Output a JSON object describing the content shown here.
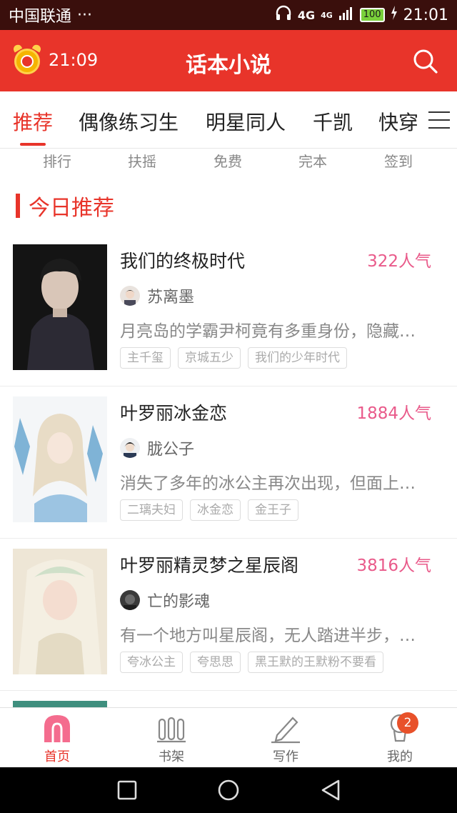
{
  "statusbar": {
    "carrier": "中国联通",
    "dots": "···",
    "network": "4G",
    "network2": "4G",
    "battery": "100",
    "time": "21:01"
  },
  "appbar": {
    "timer": "21:09",
    "title": "话本小说"
  },
  "tabs": [
    "推荐",
    "偶像练习生",
    "明星同人",
    "千凯",
    "快穿"
  ],
  "quicknav": [
    "排行",
    "扶摇",
    "免费",
    "完本",
    "签到"
  ],
  "section": {
    "title": "今日推荐"
  },
  "books": [
    {
      "name": "我们的终极时代",
      "popularity": "322人气",
      "author": "苏离墨",
      "desc": "月亮岛的学霸尹柯竟有多重身份，隐藏…",
      "tags": [
        "主千玺",
        "京城五少",
        "我们的少年时代"
      ]
    },
    {
      "name": "叶罗丽冰金恋",
      "popularity": "1884人气",
      "author": "胧公子",
      "desc": "消失了多年的冰公主再次出现，但面上…",
      "tags": [
        "二璃夫妇",
        "冰金恋",
        "金王子"
      ]
    },
    {
      "name": "叶罗丽精灵梦之星辰阁",
      "popularity": "3816人气",
      "author": "亡的影魂",
      "desc": "有一个地方叫星辰阁，无人踏进半步，…",
      "tags": [
        "夸冰公主",
        "夸思思",
        "黑王默的王默粉不要看"
      ]
    }
  ],
  "bottomnav": [
    {
      "label": "首页",
      "icon": "home-icon"
    },
    {
      "label": "书架",
      "icon": "bookshelf-icon"
    },
    {
      "label": "写作",
      "icon": "pen-icon"
    },
    {
      "label": "我的",
      "icon": "profile-icon",
      "badge": "2"
    }
  ],
  "colors": {
    "accent": "#e8342a",
    "popularity": "#e95a8a",
    "statusbar": "#3a0f0c"
  }
}
